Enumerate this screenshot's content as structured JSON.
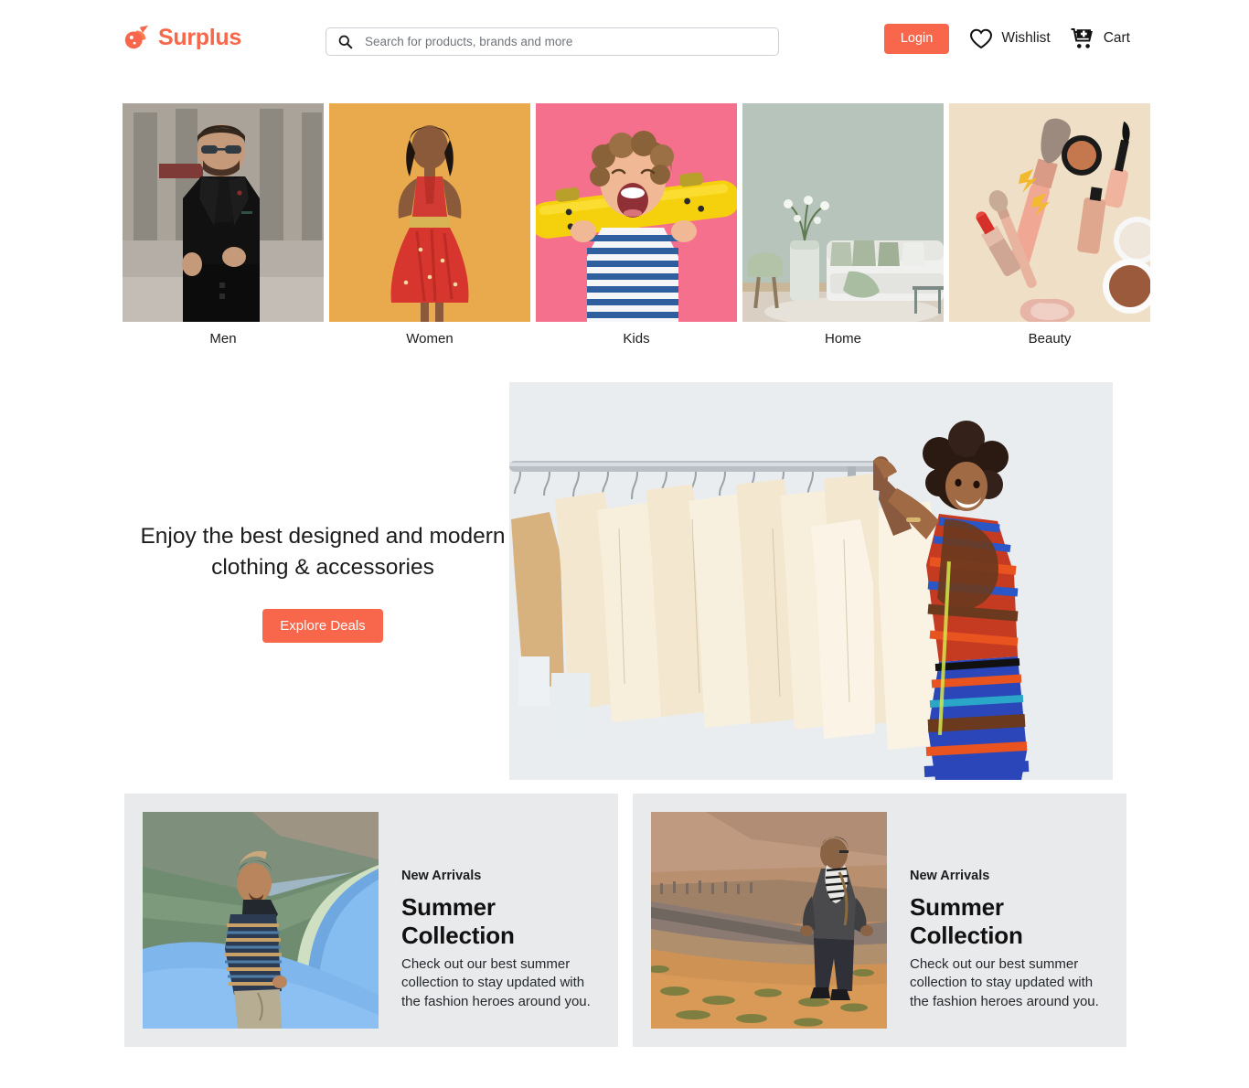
{
  "brand": {
    "name": "Surplus",
    "color": "#f8674b",
    "logo_icon": "comet-icon"
  },
  "search": {
    "placeholder": "Search for products, brands and more",
    "value": "",
    "icon": "search-icon"
  },
  "header": {
    "login_label": "Login",
    "wishlist_label": "Wishlist",
    "wishlist_icon": "heart-icon",
    "cart_label": "Cart",
    "cart_icon": "cart-plus-icon"
  },
  "categories": [
    {
      "label": "Men",
      "image": "man-in-black-suit-photo",
      "bg": "#8b8378"
    },
    {
      "label": "Women",
      "image": "woman-in-red-dress-photo",
      "bg": "#e8a84a"
    },
    {
      "label": "Kids",
      "image": "boy-with-yellow-skateboard-photo",
      "bg": "#f4708c"
    },
    {
      "label": "Home",
      "image": "living-room-sofa-photo",
      "bg": "#b9c5bc"
    },
    {
      "label": "Beauty",
      "image": "cosmetics-flatlay-photo",
      "bg": "#efdfc6"
    }
  ],
  "hero": {
    "title": "Enjoy the best designed and modern clothing & accessories",
    "button_label": "Explore Deals",
    "image": "woman-at-clothing-rack-photo",
    "bg": "#e9edf0"
  },
  "promos": [
    {
      "eyebrow": "New Arrivals",
      "title": "Summer Collection",
      "description": "Check out our best summer collection to stay updated with the fashion heroes around you.",
      "image": "man-by-blue-lake-photo"
    },
    {
      "eyebrow": "New Arrivals",
      "title": "Summer Collection",
      "description": "Check out our best summer collection to stay updated with the fashion heroes around you.",
      "image": "man-in-desert-valley-photo"
    }
  ]
}
